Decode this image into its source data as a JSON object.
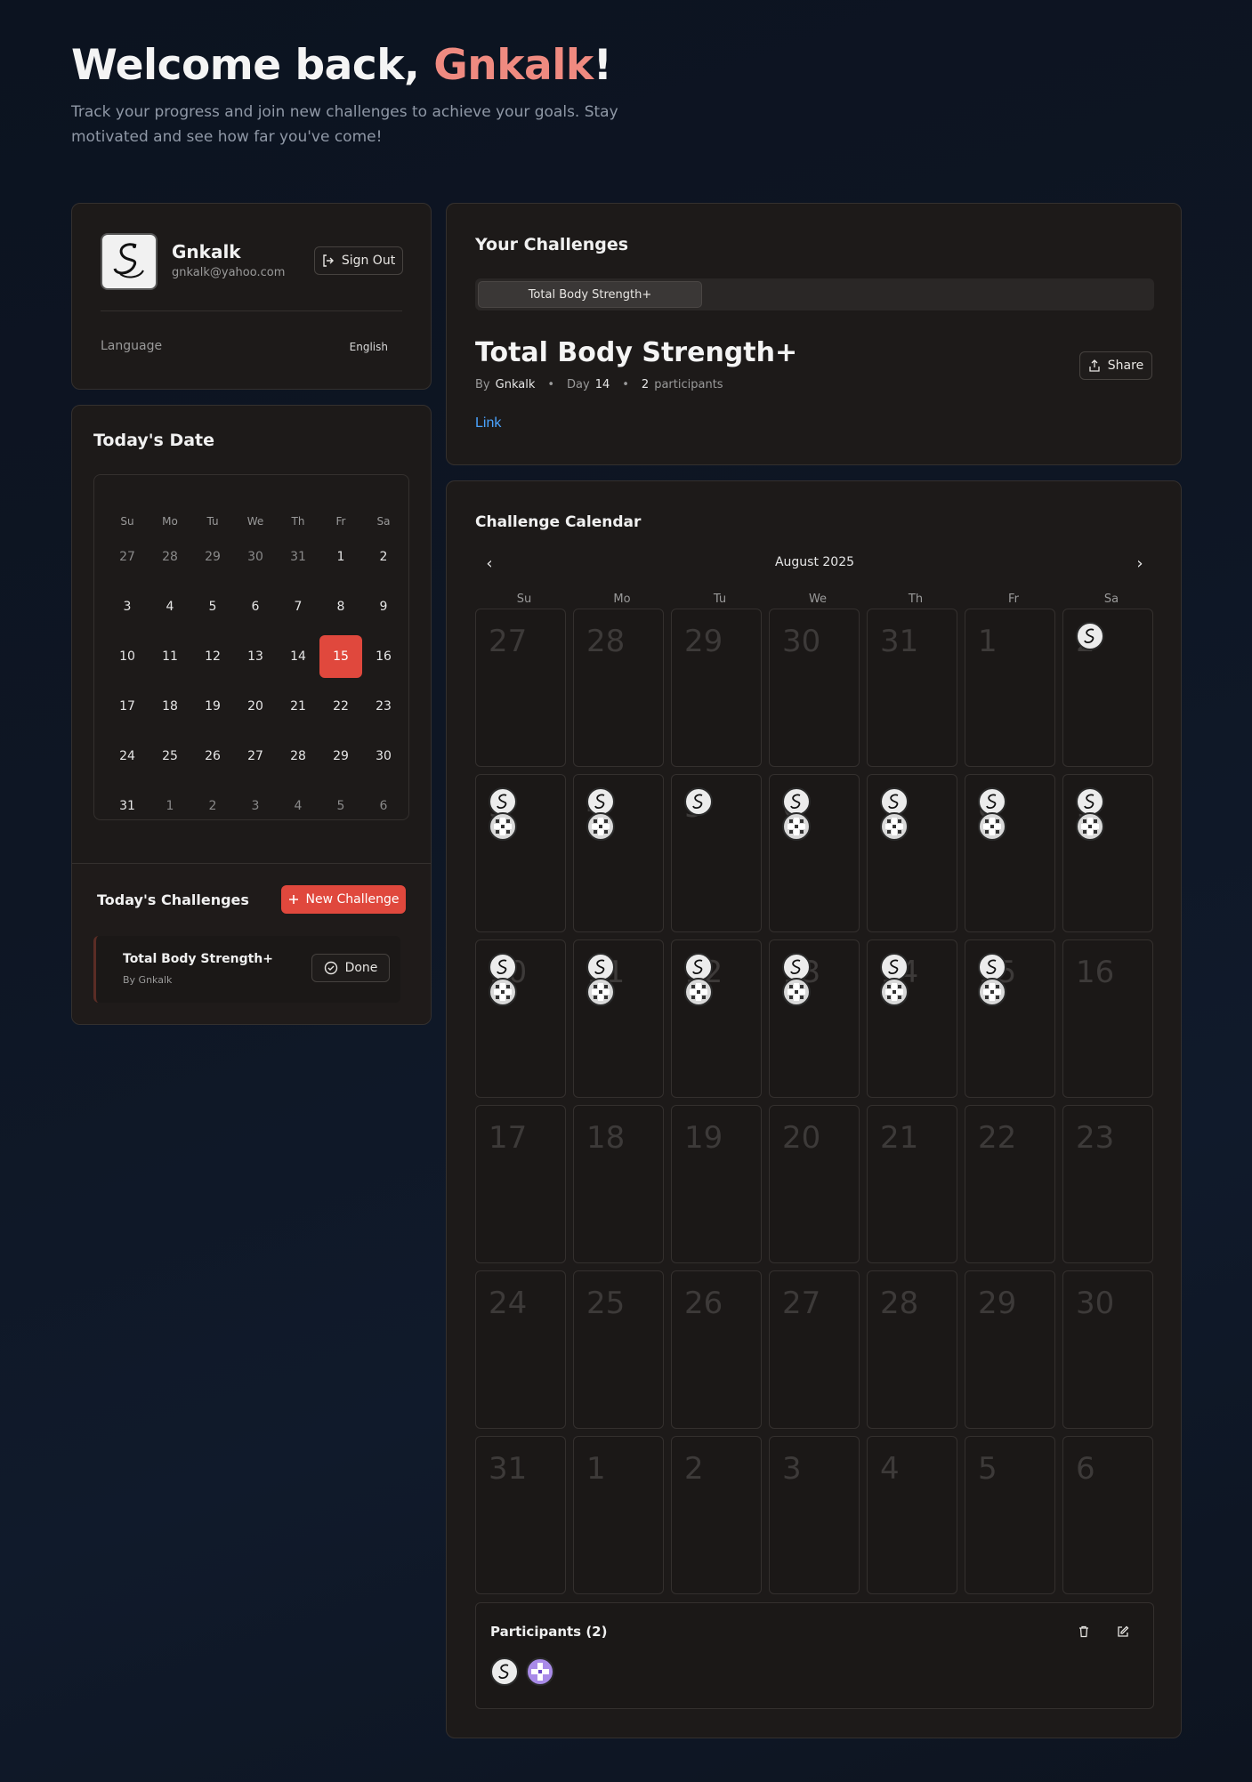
{
  "hero": {
    "greeting": "Welcome back, ",
    "name": "Gnkalk",
    "exclaim": "!",
    "subtitle": "Track your progress and join new challenges to achieve your goals. Stay motivated and see how far you've come!"
  },
  "profile": {
    "name": "Gnkalk",
    "email": "gnkalk@yahoo.com",
    "sign_out": "Sign Out",
    "language_label": "Language",
    "language_value": "English"
  },
  "today_date": {
    "title": "Today's Date",
    "weekdays": [
      "Su",
      "Mo",
      "Tu",
      "We",
      "Th",
      "Fr",
      "Sa"
    ],
    "days": [
      "27",
      "28",
      "29",
      "30",
      "31",
      "1",
      "2",
      "3",
      "4",
      "5",
      "6",
      "7",
      "8",
      "9",
      "10",
      "11",
      "12",
      "13",
      "14",
      "15",
      "16",
      "17",
      "18",
      "19",
      "20",
      "21",
      "22",
      "23",
      "24",
      "25",
      "26",
      "27",
      "28",
      "29",
      "30",
      "31",
      "1",
      "2",
      "3",
      "4",
      "5",
      "6"
    ],
    "muted_indices": [
      0,
      1,
      2,
      3,
      4,
      36,
      37,
      38,
      39,
      40,
      41
    ],
    "today_index": 19
  },
  "todays_challenges": {
    "title": "Today's Challenges",
    "new_button": "New Challenge",
    "item_title": "Total Body Strength+",
    "item_by": "By Gnkalk",
    "done_button": "Done"
  },
  "your_challenges": {
    "title": "Your Challenges",
    "tab": "Total Body Strength+",
    "challenge_title": "Total Body Strength+",
    "by_label": "By",
    "by_name": "Gnkalk",
    "day_label": "Day",
    "day_value": "14",
    "participants_count": "2",
    "participants_label": "participants",
    "share": "Share",
    "link": "Link"
  },
  "challenge_calendar": {
    "title": "Challenge Calendar",
    "month": "August 2025",
    "weekdays": [
      "Su",
      "Mo",
      "Tu",
      "We",
      "Th",
      "Fr",
      "Sa"
    ],
    "days": [
      "27",
      "28",
      "29",
      "30",
      "31",
      "1",
      "2",
      "3",
      "4",
      "5",
      "6",
      "7",
      "8",
      "9",
      "10",
      "11",
      "12",
      "13",
      "14",
      "15",
      "16",
      "17",
      "18",
      "19",
      "20",
      "21",
      "22",
      "23",
      "24",
      "25",
      "26",
      "27",
      "28",
      "29",
      "30",
      "31",
      "1",
      "2",
      "3",
      "4",
      "5",
      "6"
    ],
    "markers": {
      "6": [
        "swan"
      ],
      "7": [
        "swan",
        "cross"
      ],
      "8": [
        "swan",
        "cross"
      ],
      "9": [
        "swan"
      ],
      "10": [
        "swan",
        "cross"
      ],
      "11": [
        "swan",
        "cross"
      ],
      "12": [
        "swan",
        "cross"
      ],
      "13": [
        "swan",
        "cross"
      ],
      "14": [
        "swan",
        "cross"
      ],
      "15": [
        "swan",
        "cross"
      ],
      "16": [
        "swan",
        "cross"
      ],
      "17": [
        "swan",
        "cross"
      ],
      "18": [
        "swan",
        "cross"
      ],
      "19": [
        "swan",
        "cross"
      ]
    },
    "participants_title": "Participants (2)"
  }
}
